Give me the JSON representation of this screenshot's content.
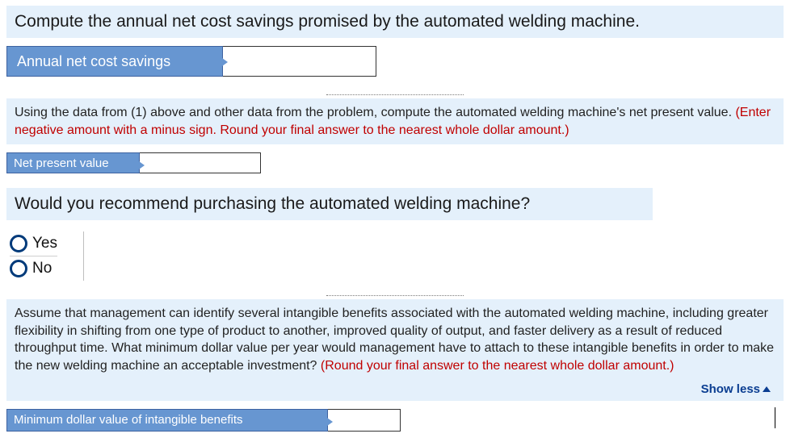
{
  "q1": {
    "prompt": "Compute the annual net cost savings promised by the automated welding machine.",
    "row_label": "Annual net cost savings",
    "value": ""
  },
  "q2": {
    "prompt_main": "Using the data from (1) above and other data from the problem, compute the automated welding machine's net present value. ",
    "prompt_note": "(Enter negative amount with a minus sign. Round your final answer to the nearest whole dollar amount.)",
    "row_label": "Net present value",
    "value": ""
  },
  "q3": {
    "prompt": "Would you recommend purchasing the automated welding machine?",
    "options": {
      "yes": "Yes",
      "no": "No"
    }
  },
  "q4": {
    "prompt_main": "Assume that management can identify several intangible benefits associated with the automated welding machine, including greater flexibility in shifting from one type of product to another, improved quality of output, and faster delivery as a result of reduced throughput time. What minimum dollar value per year would management have to attach to these intangible benefits in order to make the new welding machine an acceptable investment? ",
    "prompt_note": "(Round your final answer to the nearest whole dollar amount.)",
    "show_less": "Show less",
    "row_label": "Minimum dollar value of intangible benefits",
    "value": ""
  }
}
